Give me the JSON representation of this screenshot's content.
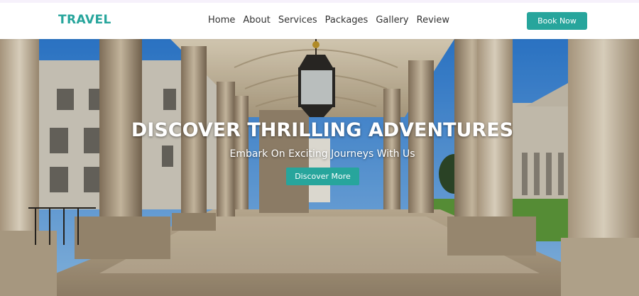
{
  "colors": {
    "accent": "#27a59c",
    "nav_text": "#333333",
    "sky": "#3f8fe0"
  },
  "navbar": {
    "brand": "TRAVEL",
    "links": [
      "Home",
      "About",
      "Services",
      "Packages",
      "Gallery",
      "Review"
    ],
    "book_label": "Book Now"
  },
  "hero": {
    "title": "DISCOVER THRILLING ADVENTURES",
    "subtitle": "Embark On Exciting Journeys With Us",
    "cta_label": "Discover More",
    "background_image": "colonnade-photo"
  }
}
